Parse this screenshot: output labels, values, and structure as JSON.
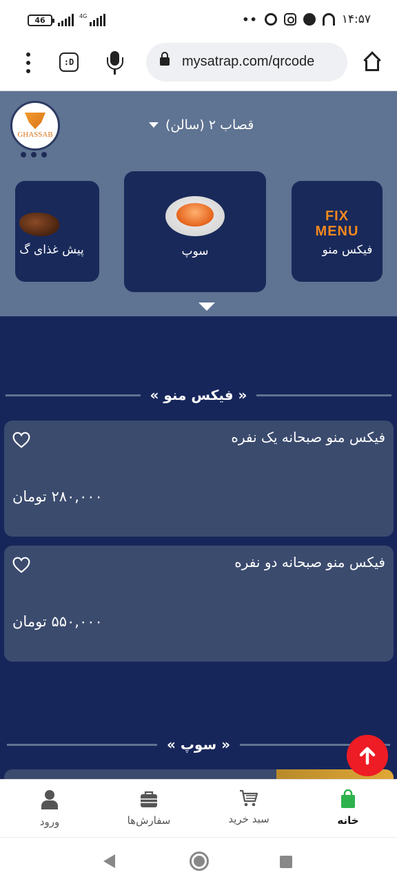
{
  "status_bar": {
    "battery": "46",
    "network": "4G",
    "time": "۱۴:۵۷",
    "more_dots": "••"
  },
  "browser": {
    "url": "mysatrap.com/qrcode",
    "colors": {
      "bar_bg": "#ffffff",
      "url_bg": "#eef0f3"
    }
  },
  "header": {
    "logo_text": "GHASSAB",
    "branch_selector": "قصاب ۲ (سالن)"
  },
  "categories": [
    {
      "label": "فیکس منو",
      "image": "fix-menu-logo",
      "logo_line1": "FIX",
      "logo_line2": "MENU"
    },
    {
      "label": "سوپ",
      "image": "soup-bowl",
      "selected": true
    },
    {
      "label": "پیش غذای گ",
      "image": "appetizer-meat"
    }
  ],
  "sections": [
    {
      "title": "« فیکس منو »",
      "items": [
        {
          "name": "فیکس منو صبحانه یک نفره",
          "price": "۲۸۰,۰۰۰ تومان"
        },
        {
          "name": "فیکس منو صبحانه دو نفره",
          "price": "۵۵۰,۰۰۰ تومان"
        }
      ]
    },
    {
      "title": "« سوپ »"
    }
  ],
  "bottom_nav": {
    "items": [
      {
        "label": "خانه",
        "icon": "shopping-bag-icon",
        "active": true
      },
      {
        "label": "سبد خرید",
        "icon": "cart-icon"
      },
      {
        "label": "سفارش‌ها",
        "icon": "briefcase-icon"
      },
      {
        "label": "ورود",
        "icon": "user-icon"
      }
    ]
  },
  "colors": {
    "page_bg": "#17265a",
    "header_bg": "#5f7392",
    "card_bg": "#3b4b6e",
    "category_card_bg": "#19295a",
    "accent_red": "#ee1c24",
    "active_green": "#2eb24c"
  }
}
